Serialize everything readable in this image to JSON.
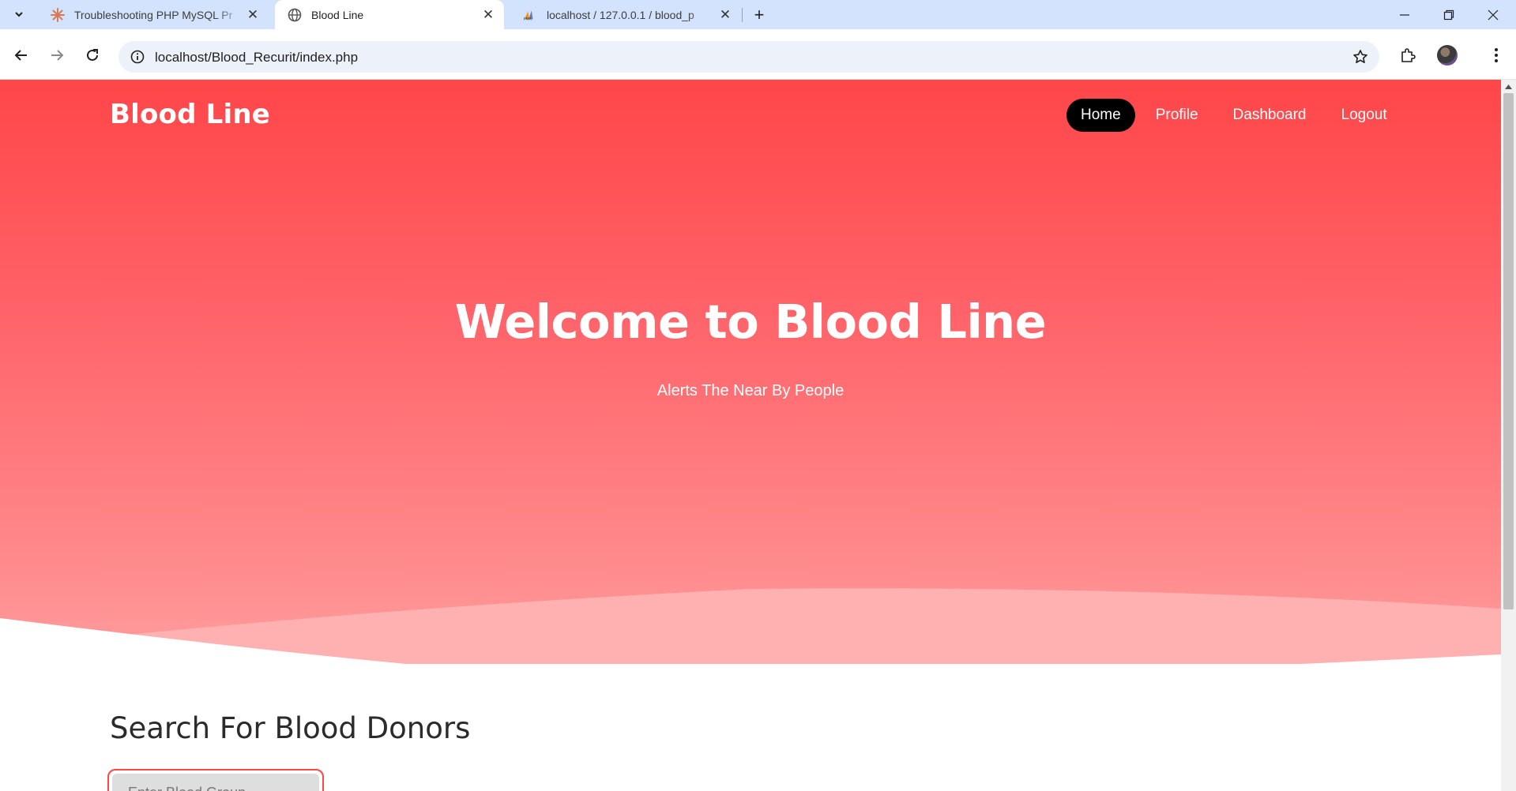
{
  "browser": {
    "tabs": [
      {
        "title": "Troubleshooting PHP MySQL Pr",
        "icon": "claude-asterisk-icon",
        "active": false
      },
      {
        "title": "Blood Line",
        "icon": "globe-icon",
        "active": true
      },
      {
        "title": "localhost / 127.0.0.1 / blood_p",
        "icon": "phpmyadmin-icon",
        "active": false
      }
    ],
    "url": "localhost/Blood_Recurit/index.php"
  },
  "header": {
    "brand": "Blood Line",
    "nav": [
      {
        "label": "Home",
        "active": true
      },
      {
        "label": "Profile",
        "active": false
      },
      {
        "label": "Dashboard",
        "active": false
      },
      {
        "label": "Logout",
        "active": false
      }
    ]
  },
  "hero": {
    "title": "Welcome to Blood Line",
    "subtitle": "Alerts The Near By People"
  },
  "search": {
    "title": "Search For Blood Donors",
    "placeholder": "Enter Blood Group"
  },
  "colors": {
    "accent": "#ff4649",
    "nav_active_bg": "#000000",
    "tab_strip": "#d3e3fd"
  }
}
